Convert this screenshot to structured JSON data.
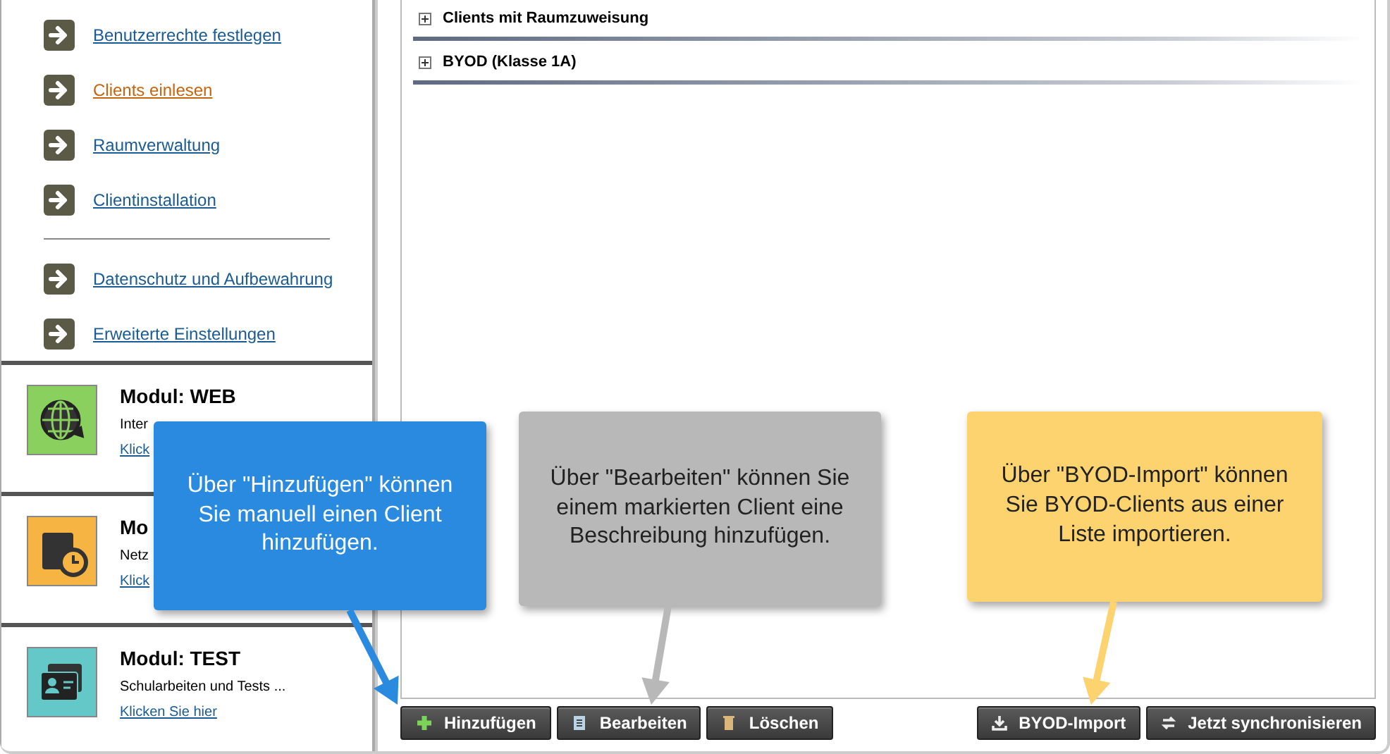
{
  "sidebar": {
    "nav_groups": [
      [
        {
          "label": "Benutzerrechte festlegen",
          "selected": false
        },
        {
          "label": "Clients einlesen",
          "selected": true
        },
        {
          "label": "Raumverwaltung",
          "selected": false
        },
        {
          "label": "Clientinstallation",
          "selected": false
        }
      ],
      [
        {
          "label": "Datenschutz und Aufbewahrung",
          "selected": false
        },
        {
          "label": "Erweiterte Einstellungen",
          "selected": false
        }
      ]
    ],
    "modules": [
      {
        "kind": "globe",
        "color": "#8ad05e",
        "title": "Modul: WEB",
        "description": "Inter",
        "link": "Klick"
      },
      {
        "kind": "calendar",
        "color": "#f6b443",
        "title": "Mo",
        "description": "Netz",
        "link": "Klick"
      },
      {
        "kind": "idcard",
        "color": "#64c8c8",
        "title": "Modul: TEST",
        "description": "Schularbeiten und Tests ...",
        "link": "Klicken Sie hier"
      }
    ]
  },
  "main": {
    "groups": [
      {
        "label": "Clients mit Raumzuweisung",
        "expanded": false
      },
      {
        "label": "BYOD (Klasse 1A)",
        "expanded": false
      }
    ],
    "buttons_left": [
      {
        "kind": "add",
        "label": "Hinzufügen"
      },
      {
        "kind": "edit",
        "label": "Bearbeiten"
      },
      {
        "kind": "delete",
        "label": "Löschen"
      }
    ],
    "buttons_right": [
      {
        "kind": "import",
        "label": "BYOD-Import"
      },
      {
        "kind": "sync",
        "label": "Jetzt synchronisieren"
      }
    ]
  },
  "callouts": [
    {
      "text": "Über \"Hinzufügen\" können Sie manuell einen Client hinzufügen.",
      "color": "#2a8ae0"
    },
    {
      "text": "Über \"Bearbeiten\" können Sie einem markierten Client eine Beschreibung hinzufügen.",
      "color": "#b8b8b8"
    },
    {
      "text": "Über \"BYOD-Import\" können Sie BYOD-Clients aus einer Liste importieren.",
      "color": "#fdd370"
    }
  ]
}
